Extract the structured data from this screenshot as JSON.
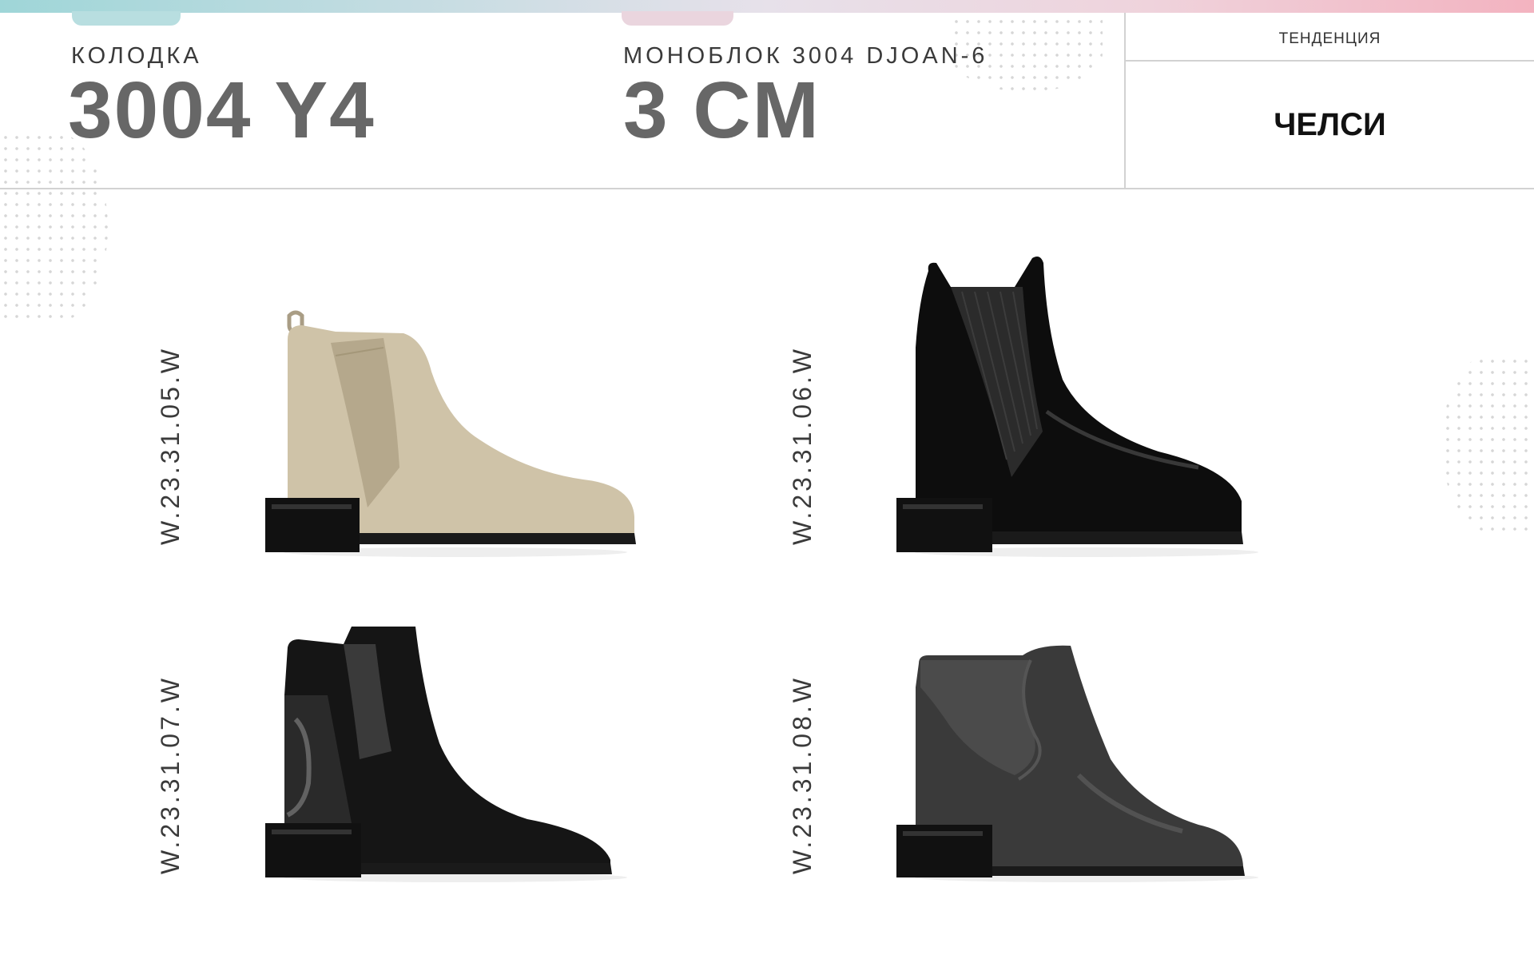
{
  "header": {
    "last_label": "КОЛОДКА",
    "last_value": "3004 Y4",
    "sole_label": "МОНОБЛОК 3004 DJOAN-6",
    "sole_value": "3 CM",
    "trend_label": "ТЕНДЕНЦИЯ",
    "trend_value": "ЧЕЛСИ"
  },
  "products": [
    {
      "code": "W.23.31.05.W",
      "material": "beige suede"
    },
    {
      "code": "W.23.31.06.W",
      "material": "black patent leather"
    },
    {
      "code": "W.23.31.07.W",
      "material": "black suede with patent heel panel"
    },
    {
      "code": "W.23.31.08.W",
      "material": "dark grey leather"
    }
  ],
  "colors": {
    "accent_teal": "#9fd6d8",
    "accent_pink": "#f3b3c0",
    "big_text_gray": "#676767",
    "divider": "#d2d2d2"
  }
}
